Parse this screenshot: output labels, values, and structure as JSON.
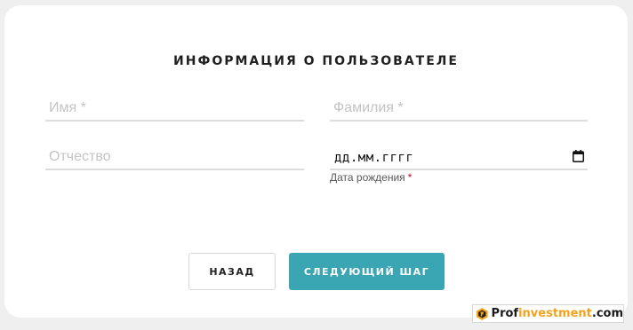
{
  "form": {
    "title": "ИНФОРМАЦИЯ О ПОЛЬЗОВАТЕЛЕ",
    "first_name": {
      "placeholder": "Имя *",
      "value": ""
    },
    "last_name": {
      "placeholder": "Фамилия *",
      "value": ""
    },
    "middle_name": {
      "placeholder": "Отчество",
      "value": ""
    },
    "birth_date": {
      "value": "дд.мм.гггг",
      "label": "Дата рождения",
      "required_mark": "*",
      "icon": "calendar-icon"
    }
  },
  "buttons": {
    "back": "НАЗАД",
    "next": "СЛЕДУЮЩИЙ ШАГ"
  },
  "watermark": {
    "part1": "Prof",
    "part2": "investment",
    "part3": ".com"
  },
  "colors": {
    "accent": "#3aa5b3",
    "required": "#d0021b",
    "watermark_accent": "#f3a21b"
  }
}
